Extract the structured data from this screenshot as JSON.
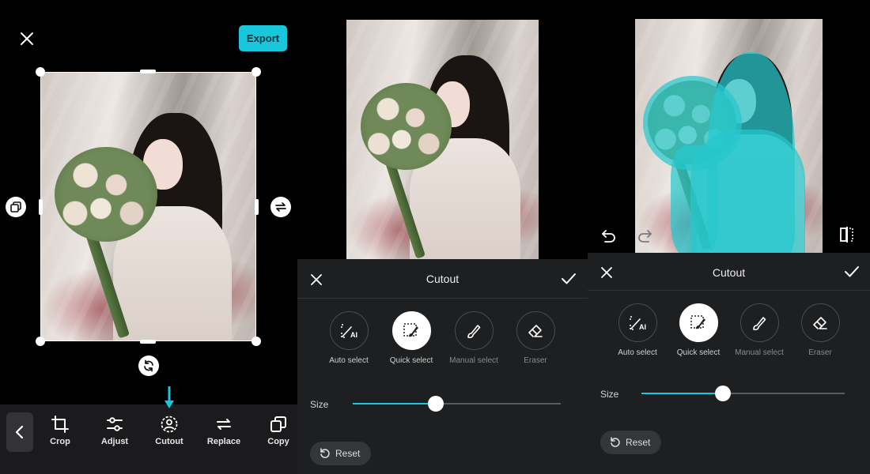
{
  "editor": {
    "export_label": "Export",
    "toolbar": [
      {
        "label": "Crop",
        "icon": "crop-icon"
      },
      {
        "label": "Adjust",
        "icon": "adjust-icon"
      },
      {
        "label": "Cutout",
        "icon": "cutout-icon"
      },
      {
        "label": "Replace",
        "icon": "replace-icon"
      },
      {
        "label": "Copy",
        "icon": "copy-icon"
      }
    ],
    "highlight_color": "#19c7dd"
  },
  "cutout_panel_a": {
    "title": "Cutout",
    "options": [
      {
        "label": "Auto select",
        "icon": "auto-select-ai-icon",
        "active": false
      },
      {
        "label": "Quick select",
        "icon": "quick-select-brush-icon",
        "active": true
      },
      {
        "label": "Manual select",
        "icon": "manual-brush-icon",
        "active": false
      },
      {
        "label": "Eraser",
        "icon": "eraser-icon",
        "active": false
      }
    ],
    "size_label": "Size",
    "size_value": 0.4,
    "reset_label": "Reset"
  },
  "cutout_panel_b": {
    "title": "Cutout",
    "options": [
      {
        "label": "Auto select",
        "icon": "auto-select-ai-icon",
        "active": false
      },
      {
        "label": "Quick select",
        "icon": "quick-select-brush-icon",
        "active": true
      },
      {
        "label": "Manual select",
        "icon": "manual-brush-icon",
        "active": false
      },
      {
        "label": "Eraser",
        "icon": "eraser-icon",
        "active": false
      }
    ],
    "size_label": "Size",
    "size_value": 0.4,
    "reset_label": "Reset"
  },
  "colors": {
    "accent": "#19c7dd",
    "sheet_bg": "#1e1f21",
    "toolbar_bg": "#1b1b1d",
    "selection_tint": "#26c8cd"
  }
}
